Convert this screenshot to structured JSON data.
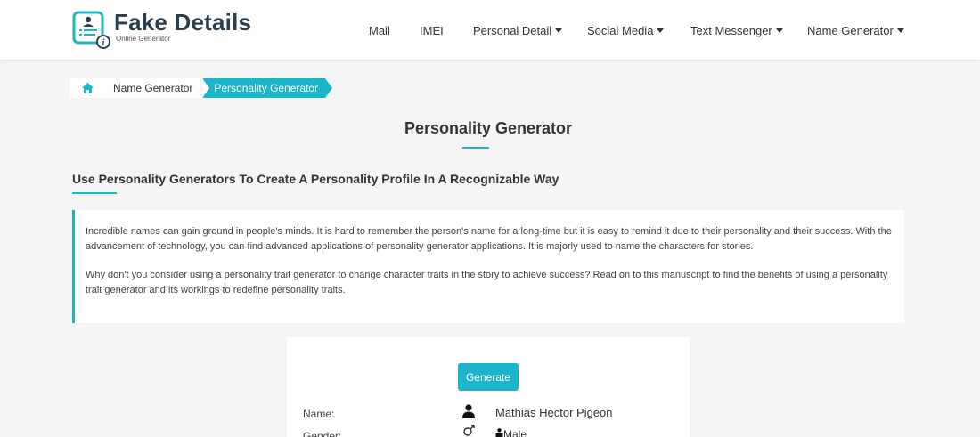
{
  "logo": {
    "title": "Fake Details",
    "subtitle": "Online Generator"
  },
  "nav": {
    "mail": "Mail",
    "imei": "IMEI",
    "personal_detail": "Personal Detail",
    "social_media": "Social Media",
    "text_messenger": "Text Messenger",
    "name_generator": "Name Generator"
  },
  "breadcrumb": {
    "parent": "Name Generator",
    "current": "Personality Generator"
  },
  "page": {
    "title": "Personality Generator",
    "subtitle": "Use Personality Generators To Create A Personality Profile In A Recognizable Way",
    "paragraph1": "Incredible names can gain ground in people's minds. It is hard to remember the person's name for a long-time but it is easy to remind it due to their personality and their success. With the advancement of technology, you can find advanced applications of personality generator applications. It is majorly used to name the characters for stories.",
    "paragraph2": "Why don't you consider using a personality trait generator to change character traits in the story to achieve success? Read on to this manuscript to find the benefits of using a personality trait generator and its workings to redefine personality traits."
  },
  "generator": {
    "button": "Generate",
    "name_label": "Name:",
    "name_value": "Mathias Hector Pigeon",
    "gender_label": "Gender:",
    "gender_value": "Male"
  },
  "colors": {
    "accent": "#1cb5c9",
    "logo_text": "#2b3e4c",
    "background": "#f5f5f5"
  }
}
